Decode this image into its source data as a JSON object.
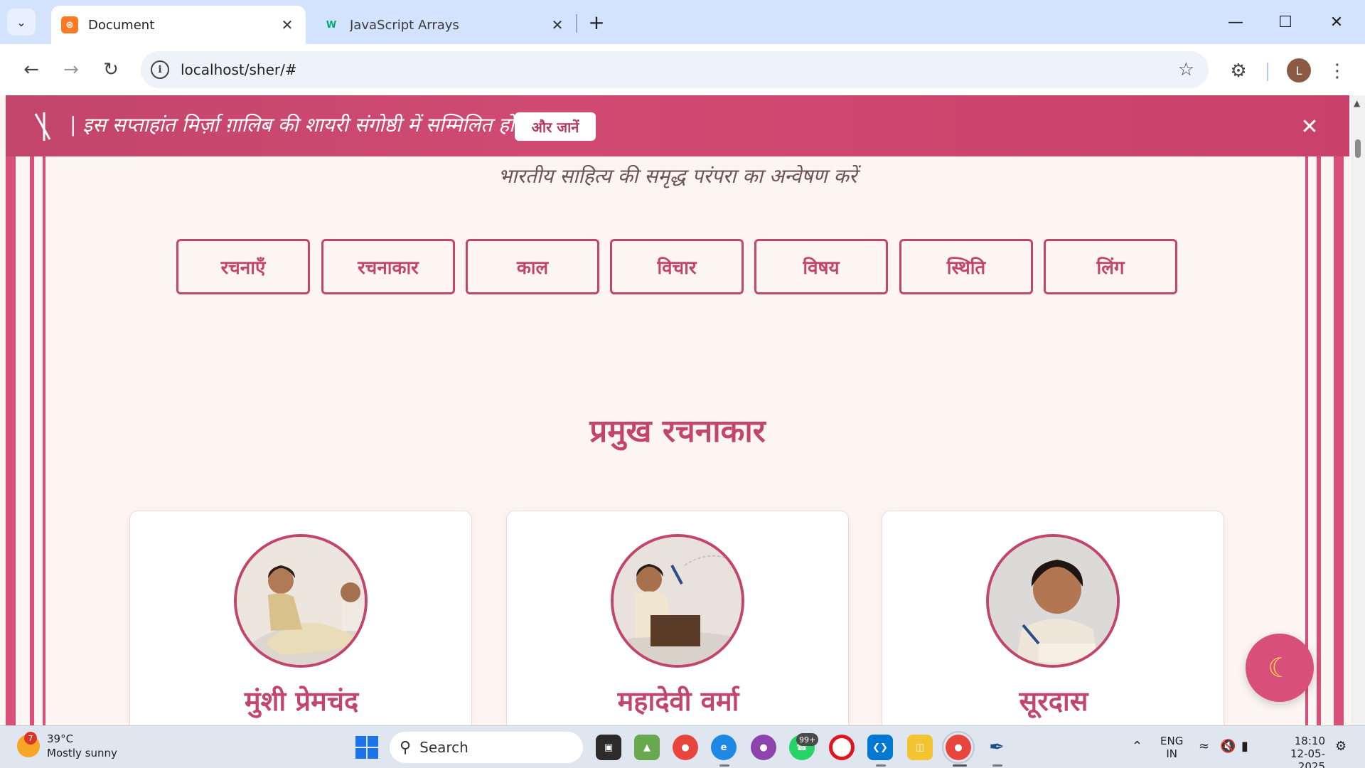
{
  "browser": {
    "tabs": [
      {
        "title": "Document",
        "favicon": "xampp-icon",
        "active": true
      },
      {
        "title": "JavaScript Arrays",
        "favicon": "w3schools-icon",
        "active": false
      }
    ],
    "url": "localhost/sher/#",
    "profile_initial": "L"
  },
  "banner": {
    "text": "| इस सप्ताहांत मिर्ज़ा ग़ालिब की शायरी संगोष्ठी में सम्मिलित हों",
    "button_label": "और जानें",
    "logo_icon": "quill-icon"
  },
  "hero": {
    "subtitle": "भारतीय साहित्य की समृद्ध परंपरा का अन्वेषण करें"
  },
  "categories": [
    {
      "label": "रचनाएँ"
    },
    {
      "label": "रचनाकार"
    },
    {
      "label": "काल"
    },
    {
      "label": "विचार"
    },
    {
      "label": "विषय"
    },
    {
      "label": "स्थिति"
    },
    {
      "label": "लिंग"
    }
  ],
  "authors_section": {
    "title": "प्रमुख रचनाकार",
    "authors": [
      {
        "name": "मुंशी प्रेमचंद"
      },
      {
        "name": "महादेवी वर्मा"
      },
      {
        "name": "सूरदास"
      }
    ]
  },
  "theme_toggle": {
    "icon": "moon-icon"
  },
  "colors": {
    "accent": "#c2456b",
    "rail": "#d94f7c",
    "page_bg": "#fdf5f1"
  },
  "taskbar": {
    "weather": {
      "temp": "39°C",
      "condition": "Mostly sunny",
      "alert_count": "7"
    },
    "search_placeholder": "Search",
    "whatsapp_badge": "99+",
    "language": {
      "line1": "ENG",
      "line2": "IN"
    },
    "clock": {
      "time": "18:10",
      "date": "12-05-2025"
    }
  }
}
